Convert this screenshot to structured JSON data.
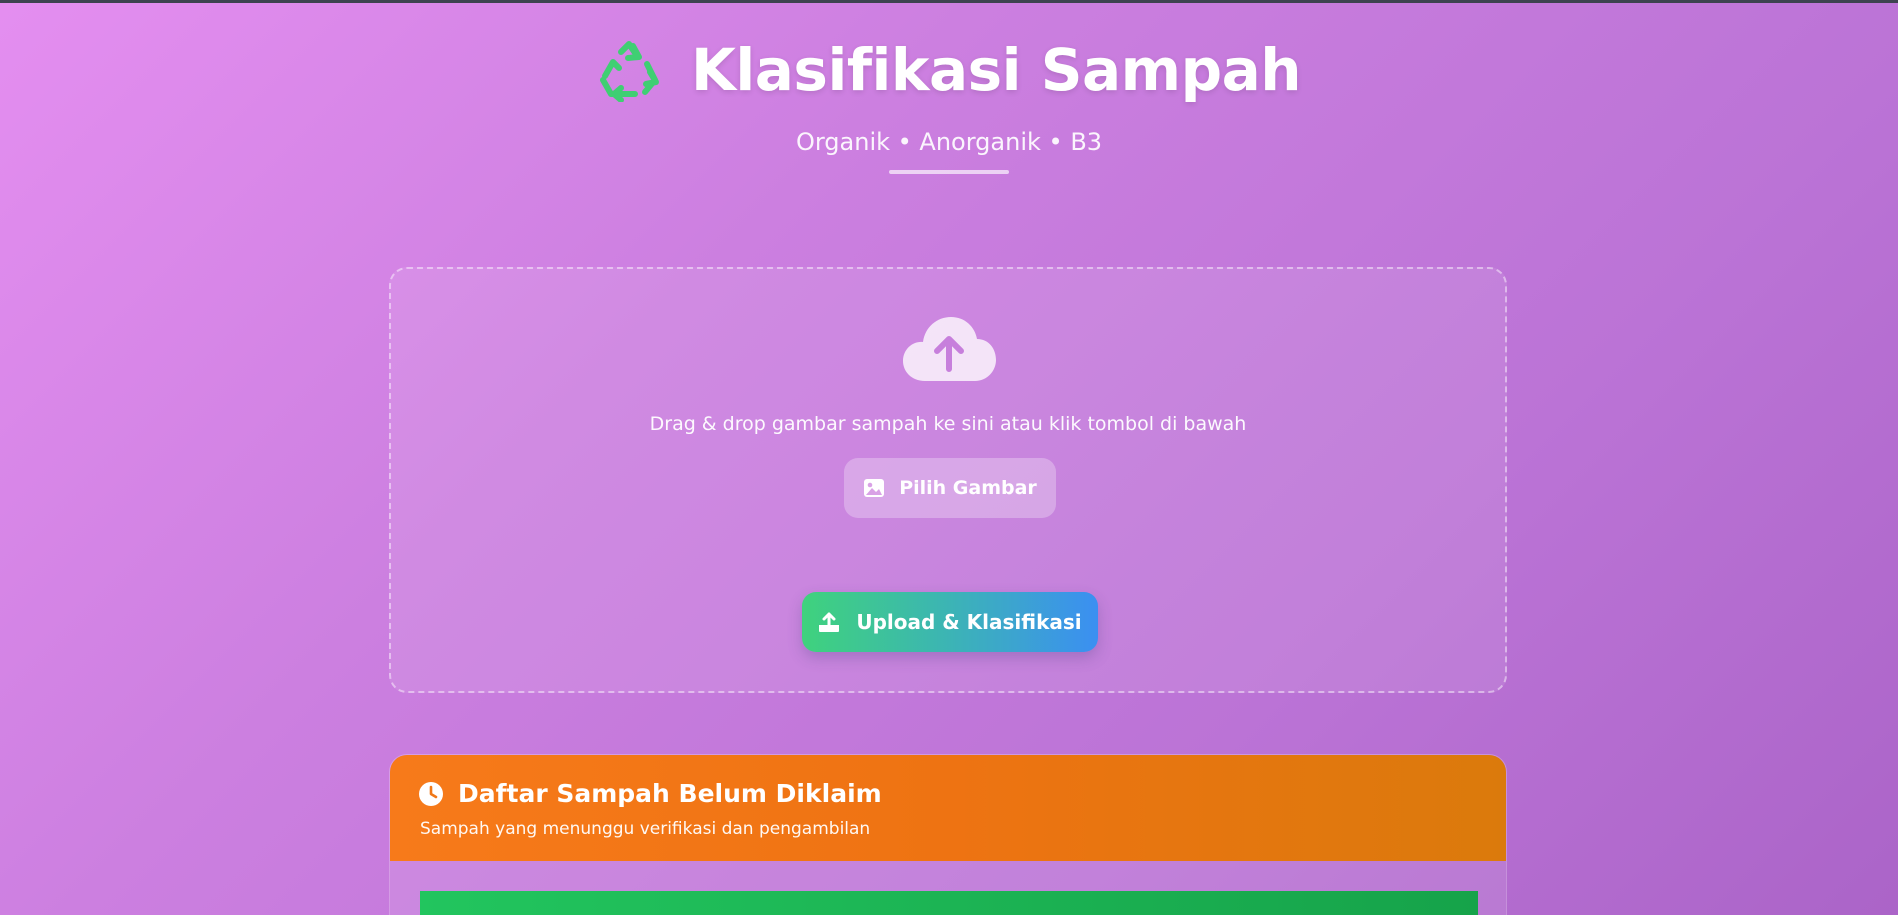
{
  "header": {
    "title": "Klasifikasi Sampah",
    "subtitle": "Organik • Anorganik • B3",
    "icon": "recycle-icon"
  },
  "upload": {
    "icon": "cloud-upload-icon",
    "drop_text": "Drag & drop gambar sampah ke sini atau klik tombol di bawah",
    "pick_label": "Pilih Gambar",
    "pick_icon": "image-icon",
    "upload_label": "Upload & Klasifikasi",
    "upload_icon": "upload-icon"
  },
  "pending": {
    "title": "Daftar Sampah Belum Diklaim",
    "description": "Sampah yang menunggu verifikasi dan pengambilan",
    "icon": "clock-icon"
  },
  "colors": {
    "accent_green": "#22c55e",
    "accent_blue": "#3b8ff2",
    "pending_orange": "#f77a1a",
    "background": "#cc7fe0"
  }
}
